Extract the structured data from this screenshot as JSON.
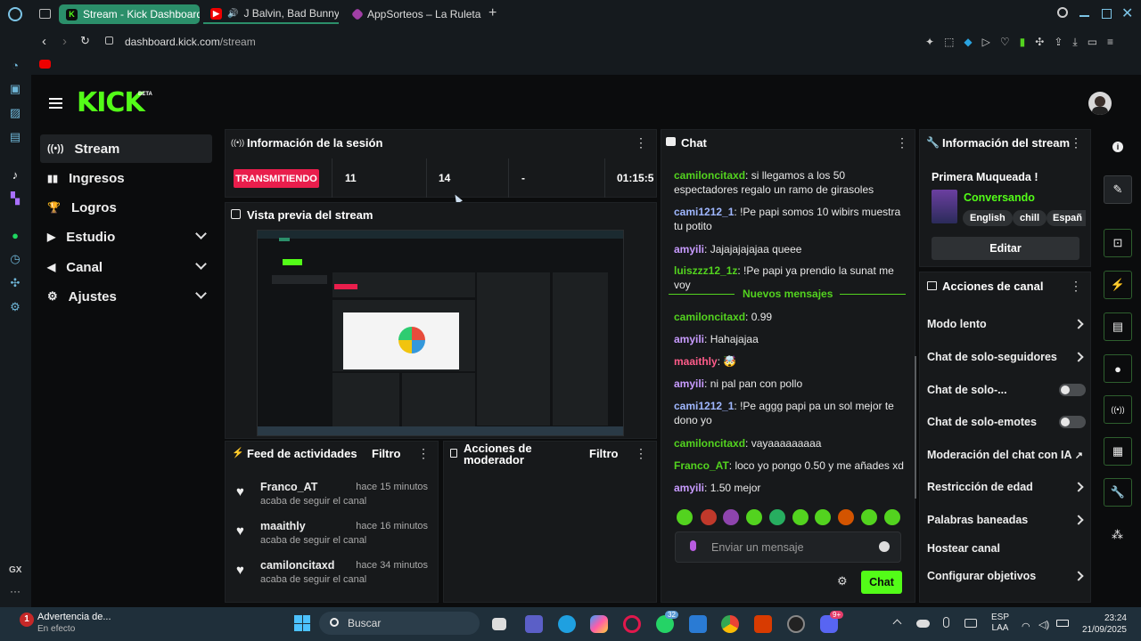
{
  "browser": {
    "tabs": [
      {
        "title": "Stream - Kick Dashboard",
        "active": true,
        "icon": "kick-icon"
      },
      {
        "title": "J Balvin, Bad Bunny -",
        "active": false,
        "icon": "youtube-icon"
      },
      {
        "title": "AppSorteos – La Ruleta de",
        "active": false,
        "icon": "appsorteos-icon"
      }
    ],
    "url_host": "dashboard.kick.com",
    "url_path": "/stream"
  },
  "kick": {
    "logo": "KICK",
    "beta": "BETA",
    "nav": [
      {
        "label": "Stream",
        "icon": "radio-icon",
        "expandable": false,
        "active": true
      },
      {
        "label": "Ingresos",
        "icon": "chart-icon",
        "expandable": false
      },
      {
        "label": "Logros",
        "icon": "trophy-icon",
        "expandable": false
      },
      {
        "label": "Estudio",
        "icon": "studio-icon",
        "expandable": true
      },
      {
        "label": "Canal",
        "icon": "megaphone-icon",
        "expandable": true
      },
      {
        "label": "Ajustes",
        "icon": "gear-icon",
        "expandable": true
      }
    ],
    "session": {
      "title": "Información de la sesión",
      "status": "TRANSMITIENDO",
      "stat1": "11",
      "stat2": "14",
      "stat3": "-",
      "time": "01:15:5"
    },
    "preview": {
      "title": "Vista previa del stream"
    },
    "feed": {
      "title": "Feed de actividades",
      "filter": "Filtro",
      "items": [
        {
          "name": "Franco_AT",
          "time": "hace 15 minutos",
          "sub": "acaba de seguir el canal"
        },
        {
          "name": "maaithly",
          "time": "hace 16 minutos",
          "sub": "acaba de seguir el canal"
        },
        {
          "name": "camiloncitaxd",
          "time": "hace 34 minutos",
          "sub": "acaba de seguir el canal"
        }
      ]
    },
    "mod": {
      "title_line1": "Acciones de",
      "title_line2": "moderador",
      "filter": "Filtro"
    },
    "chat": {
      "title": "Chat",
      "messages": [
        {
          "user": "camiloncitaxd",
          "color": "#53d31f",
          "text": "si llegamos a los 50 espectadores regalo un ramo de girasoles"
        },
        {
          "user": "cami1212_1",
          "color": "#9fb7ff",
          "text": "!Pe papi somos 10 wibirs muestra tu potito"
        },
        {
          "user": "amyili",
          "color": "#c89bff",
          "text": "Jajajajajajaa queee"
        },
        {
          "user": "luiszzz12_1z",
          "color": "#53d31f",
          "text": "!Pe papi ya prendio la sunat me voy"
        },
        {
          "user": "camiloncitaxd",
          "color": "#53d31f",
          "text": "0.99"
        },
        {
          "user": "amyili",
          "color": "#c89bff",
          "text": "Hahajajaa"
        },
        {
          "user": "maaithly",
          "color": "#ff5c8a",
          "text": "🤯"
        },
        {
          "user": "amyili",
          "color": "#c89bff",
          "text": "ni pal pan con pollo"
        },
        {
          "user": "cami1212_1",
          "color": "#9fb7ff",
          "text": "!Pe aggg papi pa un sol mejor te dono yo"
        },
        {
          "user": "camiloncitaxd",
          "color": "#53d31f",
          "text": "vayaaaaaaaaa"
        },
        {
          "user": "Franco_AT",
          "color": "#53d31f",
          "text": "loco yo pongo 0.50 y me añades xd"
        },
        {
          "user": "amyili",
          "color": "#c89bff",
          "text": "1.50 mejor"
        }
      ],
      "new_messages": "Nuevos mensajes",
      "input_placeholder": "Enviar un mensaje",
      "send": "Chat"
    },
    "stream_info": {
      "title": "Información del stream",
      "stream_title": "Primera Muqueada !",
      "category": "Conversando",
      "tags": [
        "English",
        "chill",
        "Españ"
      ],
      "edit": "Editar"
    },
    "channel_actions": {
      "title": "Acciones de canal",
      "items": [
        {
          "label": "Modo lento",
          "control": "arrow"
        },
        {
          "label": "Chat de solo-seguidores",
          "control": "arrow"
        },
        {
          "label": "Chat de solo-...",
          "control": "toggle"
        },
        {
          "label": "Chat de solo-emotes",
          "control": "toggle"
        },
        {
          "label": "Moderación del chat con IA",
          "control": "external"
        },
        {
          "label": "Restricción de edad",
          "control": "arrow"
        },
        {
          "label": "Palabras baneadas",
          "control": "arrow"
        },
        {
          "label": "Hostear canal",
          "control": "none"
        },
        {
          "label": "Configurar objetivos",
          "control": "arrow"
        }
      ]
    }
  },
  "taskbar": {
    "notification_title": "Advertencia de...",
    "notification_sub": "En efecto",
    "search": "Buscar",
    "lang1": "ESP",
    "lang2": "LAA",
    "time": "23:24",
    "date": "21/09/2025",
    "whatsapp_badge": "32",
    "discord_badge": "9+"
  },
  "colors": {
    "kick_green": "#53fc18",
    "live_red": "#e91e4c",
    "panel": "#17191b"
  }
}
